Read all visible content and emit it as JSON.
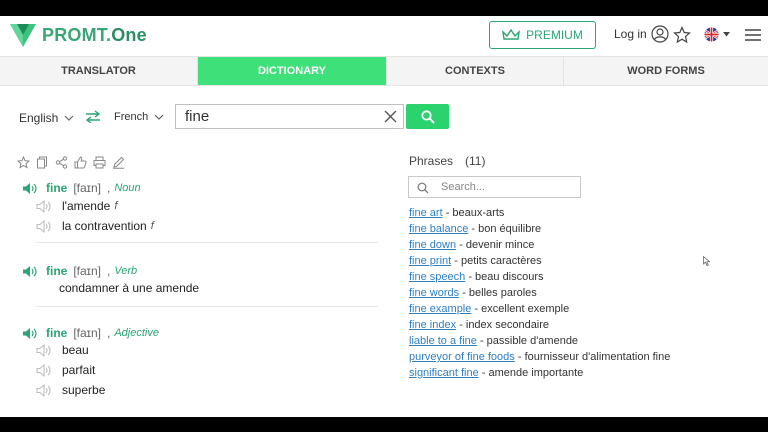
{
  "header": {
    "logo_text": "PROMT.",
    "logo_accent": "One",
    "premium_label": "PREMIUM",
    "login_label": "Log in"
  },
  "tabs": [
    {
      "label": "TRANSLATOR",
      "active": false
    },
    {
      "label": "DICTIONARY",
      "active": true
    },
    {
      "label": "CONTEXTS",
      "active": false
    },
    {
      "label": "WORD FORMS",
      "active": false
    }
  ],
  "search": {
    "source_lang": "English",
    "target_lang": "French",
    "query": "fine"
  },
  "entries": [
    {
      "word": "fine",
      "ipa": "[faɪn]",
      "pos": "Noun",
      "translations": [
        {
          "text": "l'amende",
          "gender": "f"
        },
        {
          "text": "la contravention",
          "gender": "f"
        }
      ]
    },
    {
      "word": "fine",
      "ipa": "[faɪn]",
      "pos": "Verb",
      "translations": [
        {
          "text": "condamner à une amende",
          "gender": ""
        }
      ]
    },
    {
      "word": "fine",
      "ipa": "[faɪn]",
      "pos": "Adjective",
      "translations": [
        {
          "text": "beau",
          "gender": ""
        },
        {
          "text": "parfait",
          "gender": ""
        },
        {
          "text": "superbe",
          "gender": ""
        }
      ]
    }
  ],
  "phrases": {
    "title": "Phrases",
    "count": "(11)",
    "search_placeholder": "Search...",
    "items": [
      {
        "phrase": "fine art",
        "translation": " - beaux-arts"
      },
      {
        "phrase": "fine balance",
        "translation": " - bon équilibre"
      },
      {
        "phrase": "fine down",
        "translation": " - devenir mince"
      },
      {
        "phrase": "fine print",
        "translation": " - petits caractères"
      },
      {
        "phrase": "fine speech",
        "translation": " - beau discours"
      },
      {
        "phrase": "fine words",
        "translation": " - belles paroles"
      },
      {
        "phrase": "fine example",
        "translation": " - excellent exemple"
      },
      {
        "phrase": "fine index",
        "translation": " - index secondaire"
      },
      {
        "phrase": "liable to a fine",
        "translation": " - passible d'amende"
      },
      {
        "phrase": "purveyor of fine foods",
        "translation": " - fournisseur d'alimentation fine"
      },
      {
        "phrase": "significant fine",
        "translation": " - amende importante"
      }
    ]
  },
  "colors": {
    "brand_green": "#2aa574",
    "active_tab": "#3ee07a",
    "link_blue": "#2f7fc1"
  }
}
